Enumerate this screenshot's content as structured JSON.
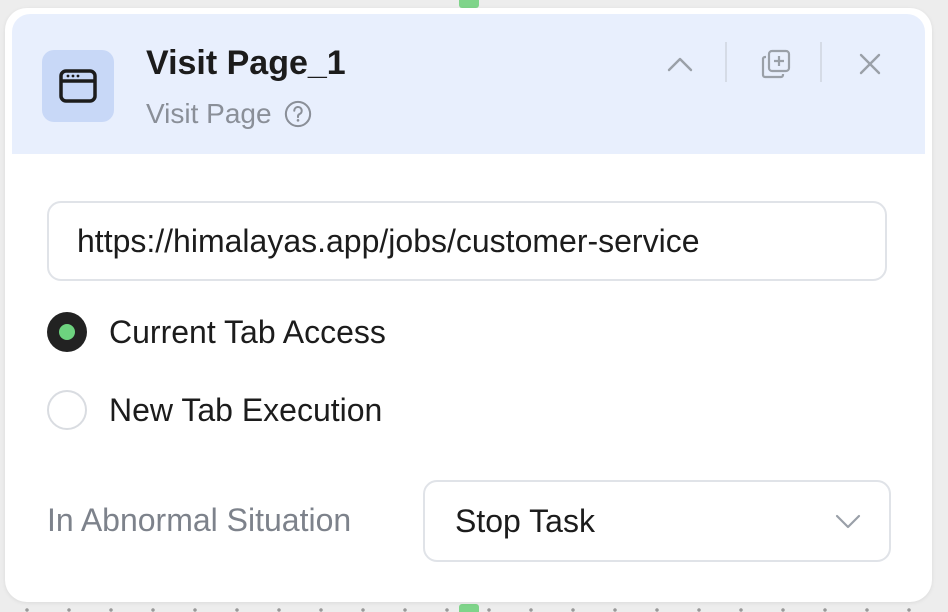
{
  "node": {
    "title": "Visit Page_1",
    "subtitle": "Visit Page",
    "icon": "browser-window-icon",
    "header_color": "#e8effd"
  },
  "header_actions": {
    "collapse_icon": "chevron-up-icon",
    "duplicate_icon": "duplicate-icon",
    "close_icon": "close-icon",
    "help_icon": "question-circle-icon"
  },
  "url_field": {
    "value": "https://himalayas.app/jobs/customer-service"
  },
  "tab_mode": {
    "options": [
      {
        "label": "Current Tab Access",
        "checked": true
      },
      {
        "label": "New Tab Execution",
        "checked": false
      }
    ],
    "selected_color": "#6dd37f"
  },
  "abnormal": {
    "label": "In Abnormal Situation",
    "selected": "Stop Task"
  }
}
